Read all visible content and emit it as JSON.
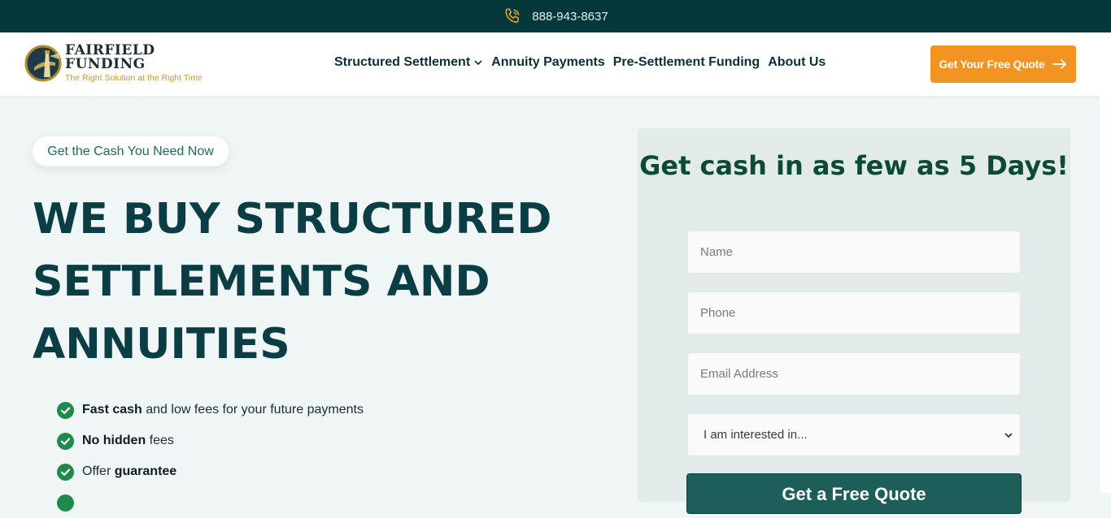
{
  "topbar": {
    "phone": "888-943-8637"
  },
  "header": {
    "logo": {
      "name": "FAIRFIELD FUNDING",
      "tagline": "The Right Solution at the Right Time"
    },
    "nav": [
      {
        "label": "Structured Settlement",
        "has_dropdown": true
      },
      {
        "label": "Annuity Payments"
      },
      {
        "label": "Pre-Settlement Funding"
      },
      {
        "label": "About Us"
      }
    ],
    "cta_label": "Get Your Free Quote"
  },
  "hero": {
    "eyebrow": "Get the Cash You Need Now",
    "headline": "WE BUY STRUCTURED SETTLEMENTS AND ANNUITIES",
    "features": [
      {
        "bold": "Fast cash",
        "rest": " and low fees for your future payments"
      },
      {
        "bold": "No hidden",
        "rest": " fees"
      },
      {
        "pre": "Offer ",
        "bold": "guarantee"
      }
    ]
  },
  "form": {
    "title": "Get cash in as few as 5 Days!",
    "name_placeholder": "Name",
    "phone_placeholder": "Phone",
    "email_placeholder": "Email Address",
    "interest_selected": "I am interested in...",
    "submit_label": "Get a Free Quote"
  },
  "colors": {
    "topbar_bg": "#04383a",
    "accent_orange": "#f39322",
    "heading_teal": "#0b3d45",
    "form_title_green": "#0c4a36",
    "check_green": "#1f8a4c",
    "submit_bg": "#1e5e5a"
  },
  "icons": {
    "phone": "phone-icon",
    "dropdown": "chevron-down-icon",
    "cta": "arrow-right-icon",
    "feature": "check-circle-icon",
    "select": "chevron-down-icon"
  }
}
